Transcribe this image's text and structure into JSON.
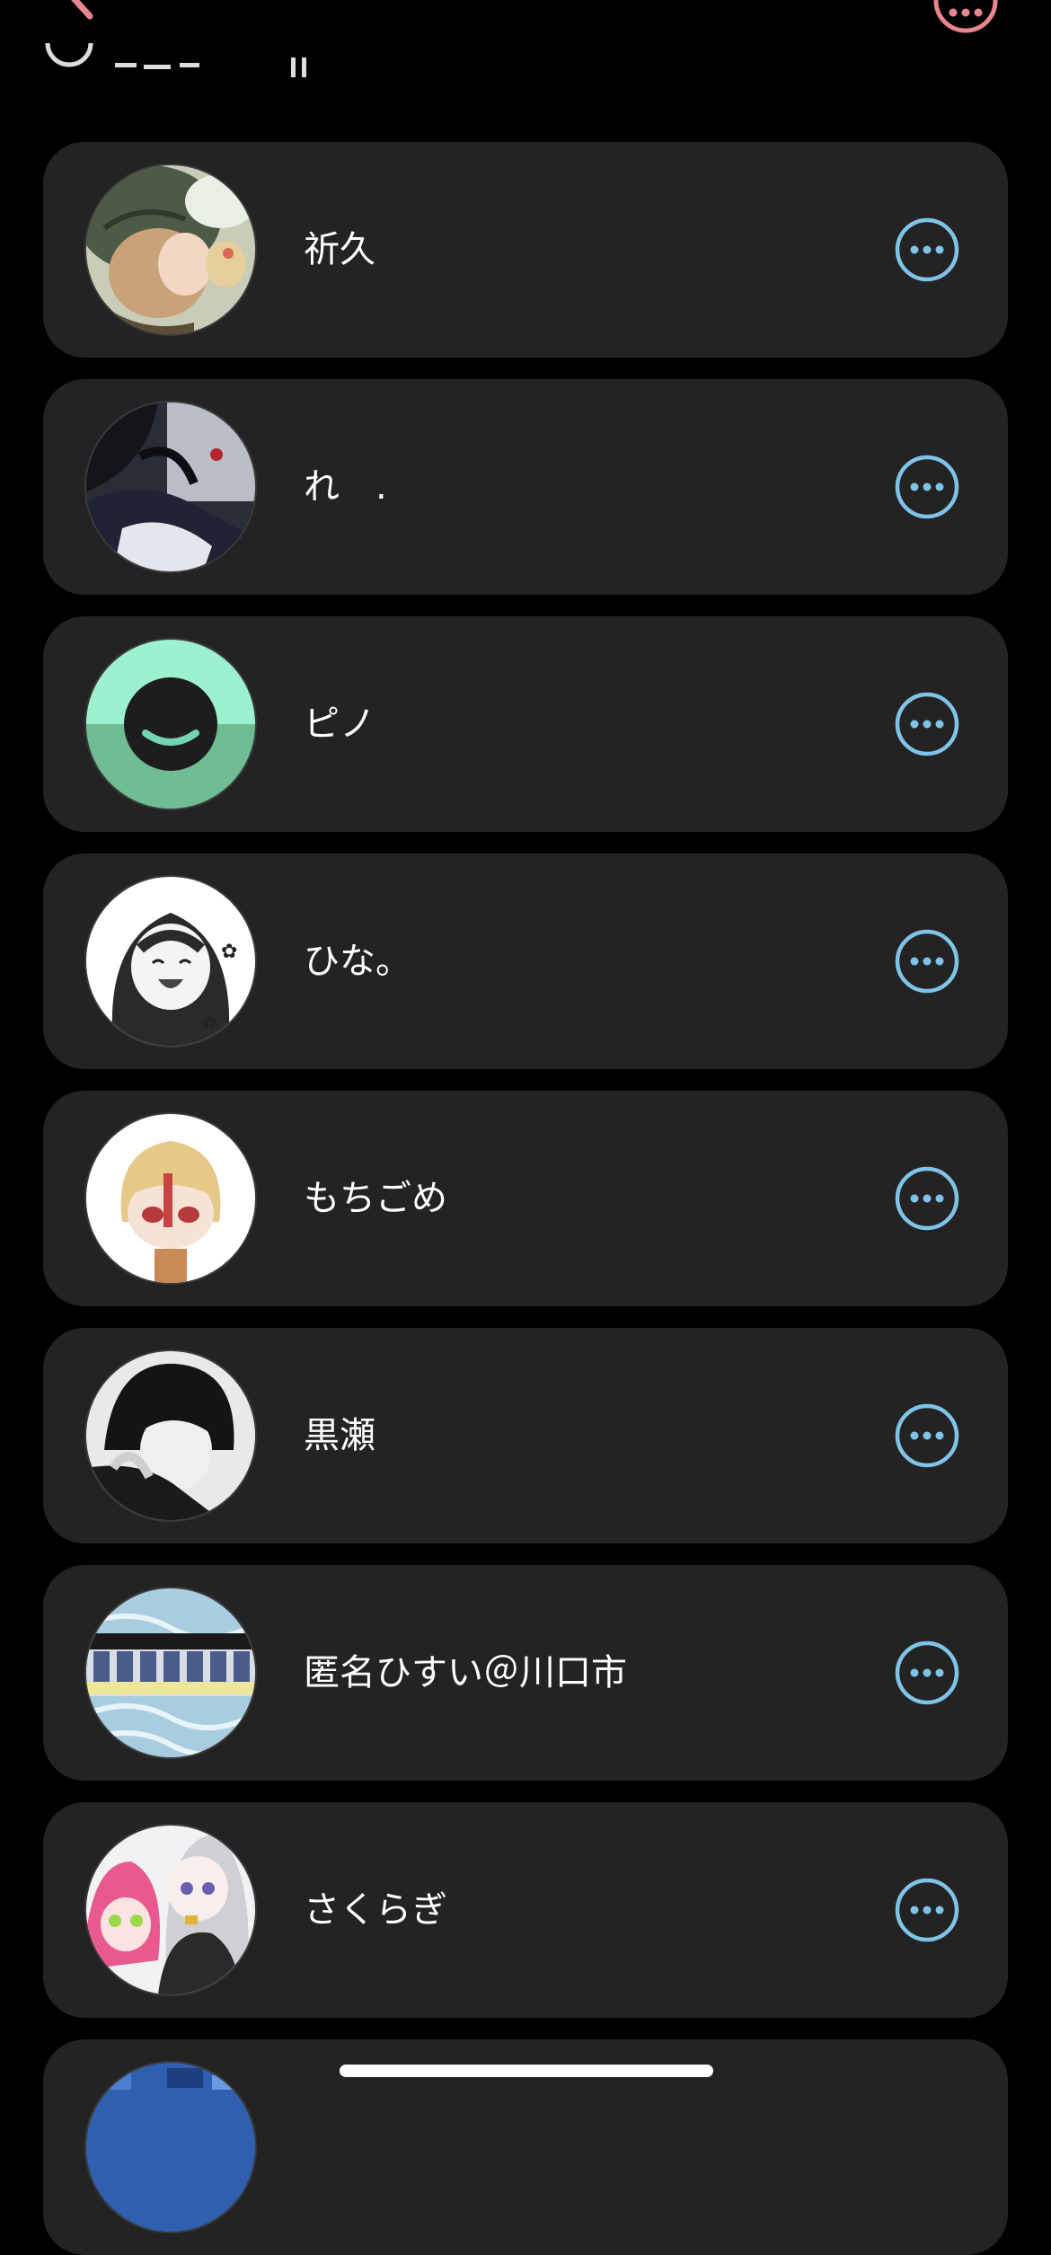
{
  "header": {
    "back_icon": "chevron-left-icon",
    "more_icon": "ellipsis-circle-icon",
    "accent_color": "#e8858f"
  },
  "members": [
    {
      "name": "祈久",
      "avatar": "illustrated-avatar-green-hat"
    },
    {
      "name": "れ　.",
      "avatar": "illustrated-avatar-dark-figure"
    },
    {
      "name": "ピノ",
      "avatar": "smiley-avatar-mint"
    },
    {
      "name": "ひな。",
      "avatar": "illustrated-avatar-monochrome-girl"
    },
    {
      "name": "もちごめ",
      "avatar": "illustrated-avatar-blonde-chibi"
    },
    {
      "name": "黒瀬",
      "avatar": "illustrated-avatar-dark-haired-boy"
    },
    {
      "name": "匿名ひすい＠川口市",
      "avatar": "illustrated-avatar-blue-pattern"
    },
    {
      "name": "さくらぎ",
      "avatar": "illustrated-avatar-pink-and-silver"
    },
    {
      "name": "",
      "avatar": "illustrated-avatar-blue-partial"
    }
  ],
  "colors": {
    "background": "#000000",
    "card": "#232323",
    "more_button": "#7fc4e8",
    "text": "#ffffff"
  }
}
